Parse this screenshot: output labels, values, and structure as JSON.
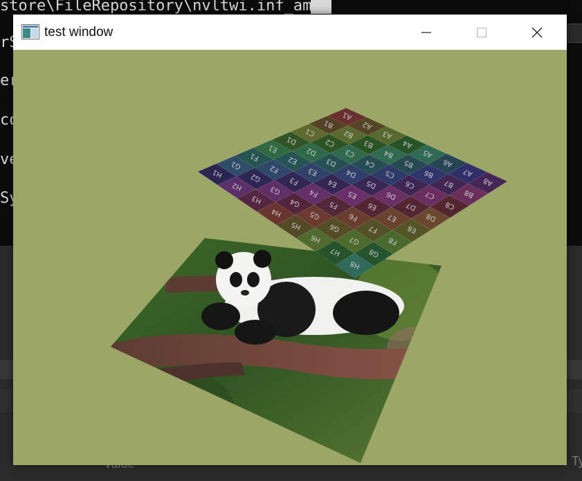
{
  "background_terminal": {
    "path_line": "store\\FileRepository\\nvltwi.inf_amd",
    "cut_lines": [
      "rS",
      "er",
      "co",
      "ve",
      "Sy"
    ],
    "footer_left": "Value",
    "footer_right": "Ty"
  },
  "window": {
    "title": "test window",
    "minimize_glyph": "—",
    "close_glyph": "✕"
  },
  "scene": {
    "clear_color": "#9ba667",
    "grid_labels": {
      "columns": [
        "A",
        "B",
        "C",
        "D",
        "E",
        "F",
        "G",
        "H"
      ],
      "rows": [
        "1",
        "2",
        "3",
        "4",
        "5",
        "6",
        "7",
        "8"
      ]
    },
    "photo_subject": "panda on tree branch"
  },
  "colors": {
    "titlebar_bg": "#ffffff",
    "window_content_bg": "#9ba667",
    "terminal_bg": "#0c0c0c"
  }
}
